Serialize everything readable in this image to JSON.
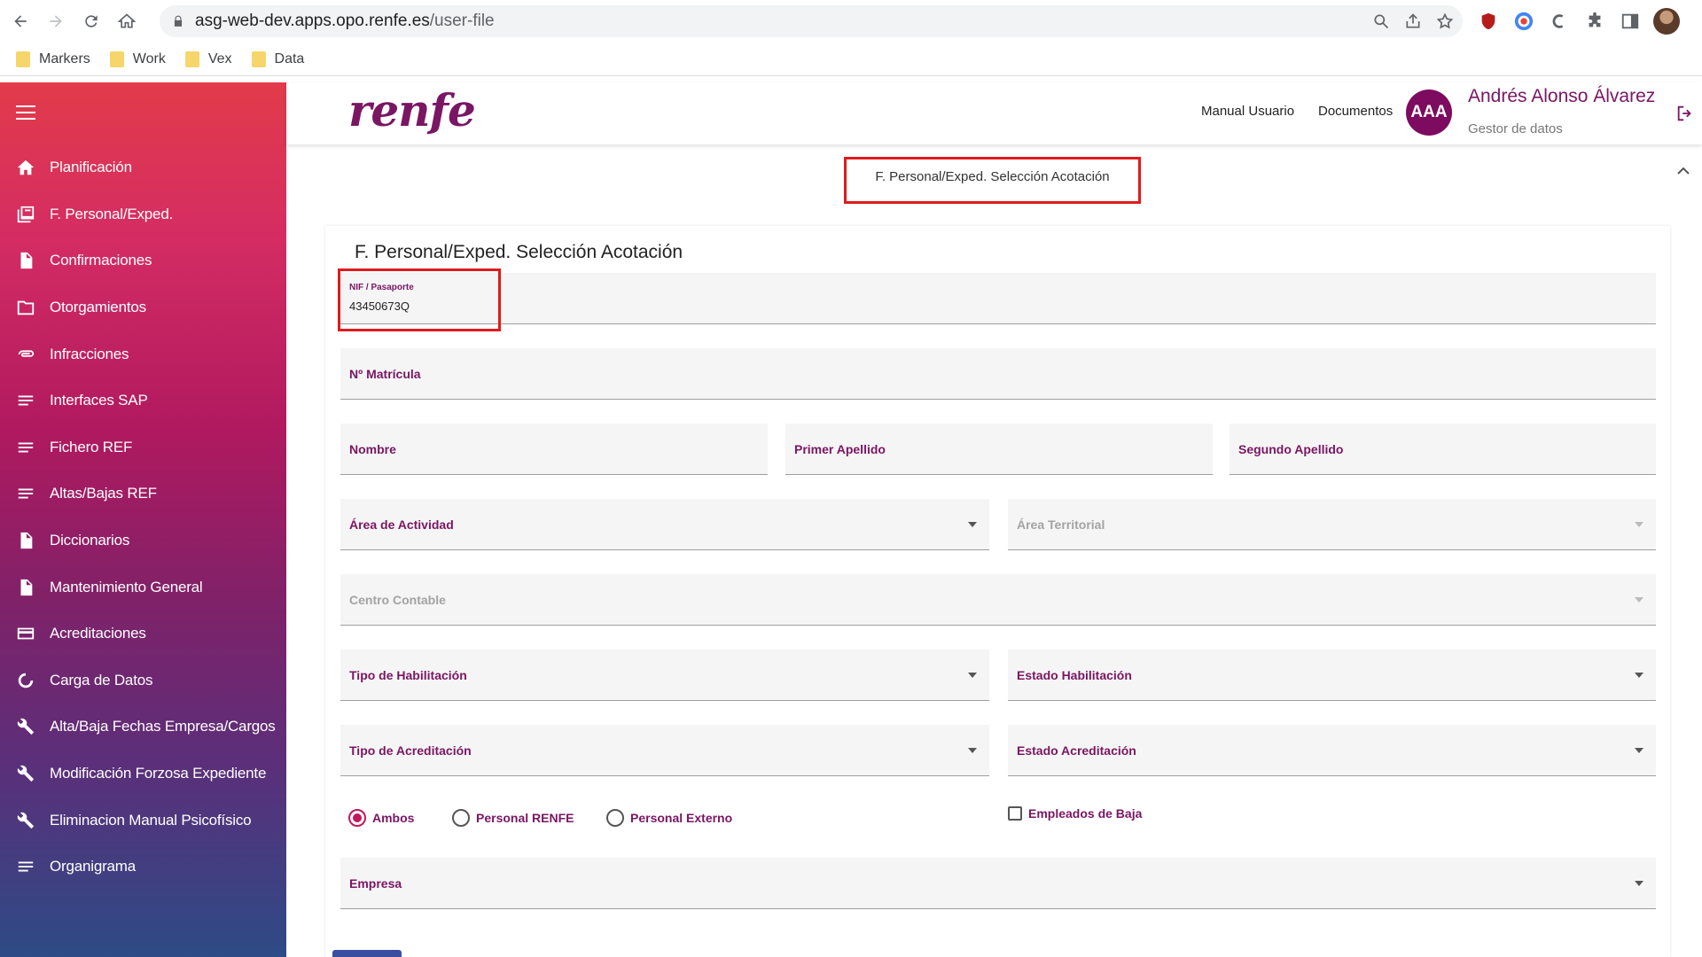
{
  "browser": {
    "url_host": "asg-web-dev.apps.opo.renfe.es",
    "url_path": "/user-file",
    "bookmarks": [
      "Markers",
      "Work",
      "Vex",
      "Data"
    ]
  },
  "sidebar": {
    "items": [
      {
        "label": "Planificación",
        "icon": "home-icon"
      },
      {
        "label": "F. Personal/Exped.",
        "icon": "library-icon"
      },
      {
        "label": "Confirmaciones",
        "icon": "document-icon"
      },
      {
        "label": "Otorgamientos",
        "icon": "folder-icon"
      },
      {
        "label": "Infracciones",
        "icon": "paperclip-icon"
      },
      {
        "label": "Interfaces SAP",
        "icon": "lines-icon"
      },
      {
        "label": "Fichero REF",
        "icon": "lines-icon"
      },
      {
        "label": "Altas/Bajas REF",
        "icon": "lines-icon"
      },
      {
        "label": "Diccionarios",
        "icon": "document-icon"
      },
      {
        "label": "Mantenimiento General",
        "icon": "document-icon"
      },
      {
        "label": "Acreditaciones",
        "icon": "card-icon"
      },
      {
        "label": "Carga de Datos",
        "icon": "loading-icon"
      },
      {
        "label": "Alta/Baja Fechas Empresa/Cargos",
        "icon": "wrench-icon"
      },
      {
        "label": "Modificación Forzosa Expediente",
        "icon": "wrench-icon"
      },
      {
        "label": "Eliminacion Manual Psicofísico",
        "icon": "wrench-icon"
      },
      {
        "label": "Organigrama",
        "icon": "lines-icon"
      }
    ]
  },
  "header": {
    "logo": "renfe",
    "manual_link": "Manual Usuario",
    "docs_link": "Documentos",
    "avatar_initials": "AAA",
    "user_name": "Andrés Alonso Álvarez",
    "user_role": "Gestor de datos"
  },
  "breadcrumb": "F. Personal/Exped. Selección Acotación",
  "form": {
    "title": "F. Personal/Exped. Selección Acotación",
    "nif_label": "NIF / Pasaporte",
    "nif_value": "43450673Q",
    "matricula": "Nº Matrícula",
    "nombre": "Nombre",
    "primer_apellido": "Primer Apellido",
    "segundo_apellido": "Segundo Apellido",
    "area_actividad": "Área de Actividad",
    "area_territorial": "Área Territorial",
    "centro_contable": "Centro Contable",
    "tipo_habilitacion": "Tipo de Habilitación",
    "estado_habilitacion": "Estado Habilitación",
    "tipo_acreditacion": "Tipo de Acreditación",
    "estado_acreditacion": "Estado Acreditación",
    "radio_ambos": "Ambos",
    "radio_renfe": "Personal RENFE",
    "radio_externo": "Personal Externo",
    "checkbox_baja": "Empleados de Baja",
    "empresa": "Empresa",
    "selected_radio": "Ambos"
  },
  "colors": {
    "brand": "#7a1663",
    "highlight": "#e01b1b",
    "radio_accent": "#c2185b"
  }
}
